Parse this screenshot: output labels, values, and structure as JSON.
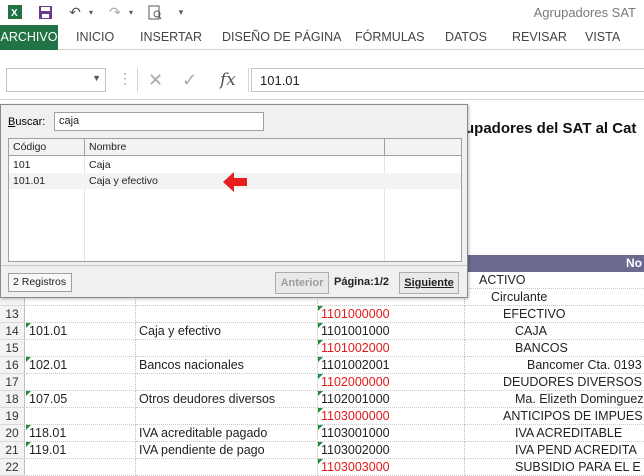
{
  "app": {
    "title": "Agrupadores SAT"
  },
  "quick_access": [
    "excel-icon",
    "save-icon",
    "undo-icon",
    "redo-icon",
    "print-preview-icon",
    "customize-icon"
  ],
  "ribbon": {
    "tabs": [
      "ARCHIVO",
      "INICIO",
      "INSERTAR",
      "DISEÑO DE PÁGINA",
      "FÓRMULAS",
      "DATOS",
      "REVISAR",
      "VISTA"
    ]
  },
  "formula_bar": {
    "name_box": "",
    "value": "101.01",
    "fx_label": "fx"
  },
  "sheet": {
    "title": "upadores del SAT al Cat",
    "header_label": "No",
    "rows": [
      {
        "num": "",
        "a": "",
        "b": "",
        "c": "",
        "d": "ACTIVO",
        "c_red": false
      },
      {
        "num": "",
        "a": "",
        "b": "",
        "c": "",
        "d": "Circulante",
        "c_red": false
      },
      {
        "num": "13",
        "a": "",
        "b": "",
        "c": "1101000000",
        "d": "EFECTIVO",
        "c_red": true
      },
      {
        "num": "14",
        "a": "101.01",
        "b": "Caja y efectivo",
        "c": "1101001000",
        "d": "CAJA",
        "c_red": false
      },
      {
        "num": "15",
        "a": "",
        "b": "",
        "c": "1101002000",
        "d": "BANCOS",
        "c_red": true
      },
      {
        "num": "16",
        "a": "102.01",
        "b": "Bancos nacionales",
        "c": "1101002001",
        "d": "Bancomer Cta. 0193",
        "c_red": false
      },
      {
        "num": "17",
        "a": "",
        "b": "",
        "c": "1102000000",
        "d": "DEUDORES DIVERSOS",
        "c_red": true
      },
      {
        "num": "18",
        "a": "107.05",
        "b": "Otros deudores diversos",
        "c": "1102001000",
        "d": "Ma. Elizeth Dominguez",
        "c_red": false
      },
      {
        "num": "19",
        "a": "",
        "b": "",
        "c": "1103000000",
        "d": "ANTICIPOS DE IMPUES",
        "c_red": true
      },
      {
        "num": "20",
        "a": "118.01",
        "b": "IVA acreditable pagado",
        "c": "1103001000",
        "d": "IVA ACREDITABLE",
        "c_red": false
      },
      {
        "num": "21",
        "a": "119.01",
        "b": "IVA pendiente de pago",
        "c": "1103002000",
        "d": "IVA PEND ACREDITA",
        "c_red": false
      },
      {
        "num": "22",
        "a": "",
        "b": "",
        "c": "1103003000",
        "d": "SUBSIDIO PARA EL E",
        "c_red": true
      }
    ]
  },
  "dialog": {
    "search_label": "Buscar:",
    "search_value": "caja",
    "columns": [
      "Código",
      "Nombre"
    ],
    "results": [
      {
        "code": "101",
        "name": "Caja"
      },
      {
        "code": "101.01",
        "name": "Caja y efectivo"
      }
    ],
    "record_count": "2 Registros",
    "prev_label": "Anterior",
    "page_label": "Página:1/2",
    "next_label": "Siguiente"
  },
  "colors": {
    "file_tab": "#217346",
    "header_strip": "#6d6a91",
    "red_text": "#e01a1a",
    "arrow": "#e81e1e"
  }
}
